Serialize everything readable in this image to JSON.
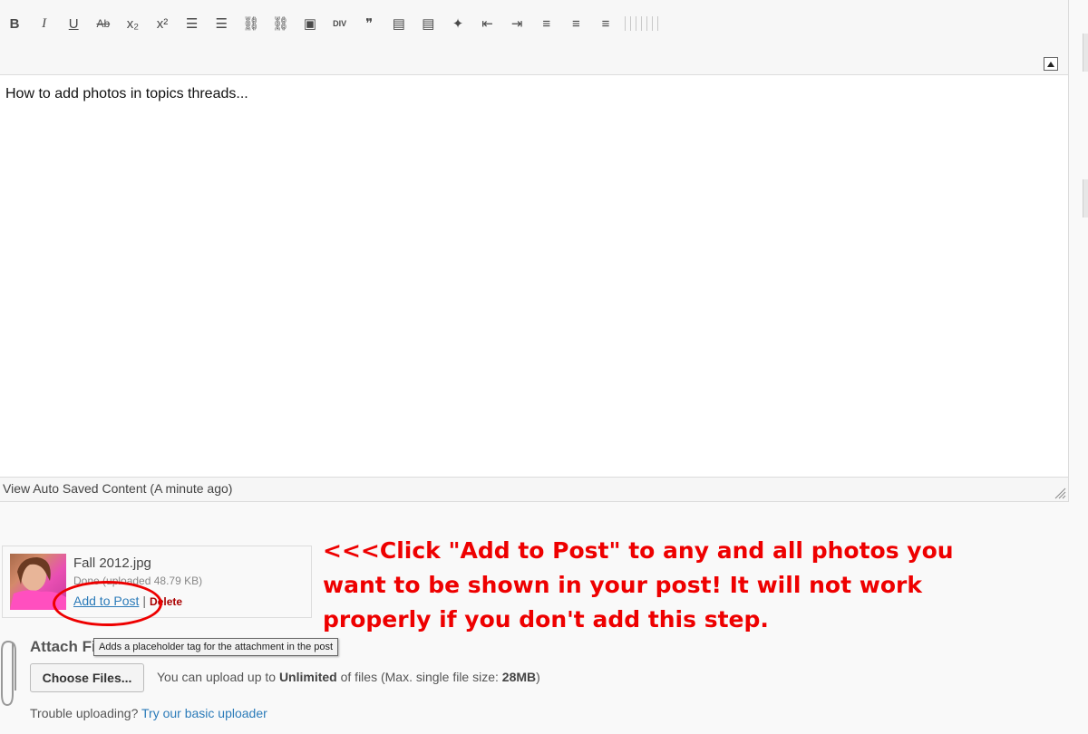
{
  "toolbar": {
    "buttons": [
      {
        "name": "bold-button",
        "glyph": "B"
      },
      {
        "name": "italic-button",
        "glyph": "I"
      },
      {
        "name": "underline-button",
        "glyph": "U"
      },
      {
        "name": "strikethrough-button",
        "glyph": "Ab"
      },
      {
        "name": "subscript-button",
        "glyph": "x₂"
      },
      {
        "name": "superscript-button",
        "glyph": "x²"
      },
      {
        "name": "bullet-list-button",
        "glyph": "☰"
      },
      {
        "name": "numbered-list-button",
        "glyph": "☰"
      },
      {
        "name": "link-button",
        "glyph": "⛓"
      },
      {
        "name": "unlink-button",
        "glyph": "⛓"
      },
      {
        "name": "image-button",
        "glyph": "▣"
      },
      {
        "name": "div-button",
        "glyph": "DIV"
      },
      {
        "name": "blockquote-button",
        "glyph": "❞"
      },
      {
        "name": "table-button",
        "glyph": "▤"
      },
      {
        "name": "table-row-button",
        "glyph": "▤"
      },
      {
        "name": "twitter-button",
        "glyph": "✦"
      },
      {
        "name": "outdent-button",
        "glyph": "⇤"
      },
      {
        "name": "indent-button",
        "glyph": "⇥"
      },
      {
        "name": "align-left-button",
        "glyph": "≡"
      },
      {
        "name": "align-center-button",
        "glyph": "≡"
      },
      {
        "name": "align-right-button",
        "glyph": "≡"
      }
    ]
  },
  "editor": {
    "content": "How to add photos in topics threads..."
  },
  "status_bar": {
    "autosave_text": "View Auto Saved Content (A minute ago)"
  },
  "attachment": {
    "file_name": "Fall 2012.jpg",
    "status": "Done (uploaded 48.79 KB)",
    "add_to_post": "Add to Post",
    "separator": "|",
    "delete": "Delete",
    "tooltip": "Adds a placeholder tag for the attachment in the post"
  },
  "annotation": {
    "text": "<<<Click \"Add to Post\" to any and all photos you want to be shown in your post! It will not work properly if you don't add this step.",
    "color": "#e00000"
  },
  "attach_files": {
    "title": "Attach Files",
    "choose_button": "Choose Files...",
    "info_prefix": "You can upload up to ",
    "info_limit": "Unlimited",
    "info_middle": " of files (Max. single file size: ",
    "info_size": "28MB",
    "info_suffix": ")",
    "trouble_text": "Trouble uploading?",
    "trouble_link": "Try our basic uploader"
  }
}
